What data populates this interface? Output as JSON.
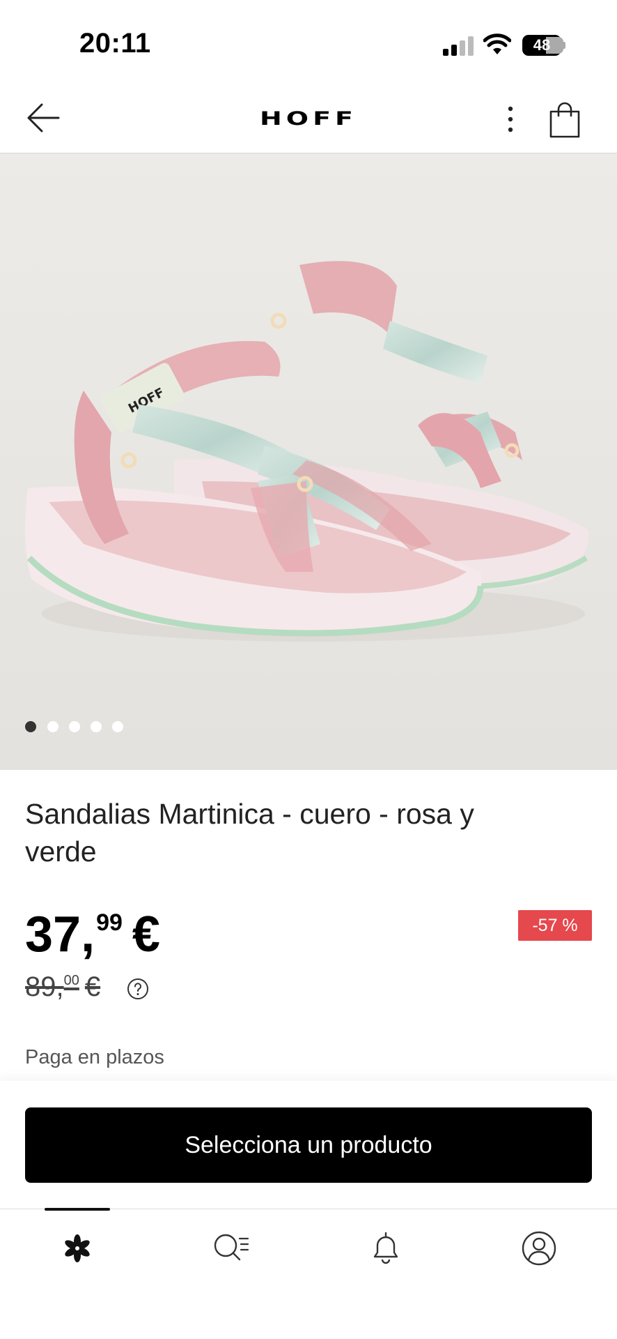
{
  "status_bar": {
    "time": "20:11",
    "battery": "48"
  },
  "header": {
    "brand": "HOFF",
    "icons": [
      "back-arrow-icon",
      "more-vertical-icon",
      "shopping-bag-icon"
    ]
  },
  "gallery": {
    "image_alt": "Sandalias Martinica rosa y verde",
    "dots": 5,
    "active_dot": 1,
    "brand_tag": "HOFF"
  },
  "product": {
    "title": "Sandalias Martinica - cuero - rosa y verde",
    "price_int": "37,",
    "price_dec": "99",
    "price_currency": "€",
    "discount": "-57 %",
    "old_price_int": "89,",
    "old_price_dec": "00",
    "old_price_currency": "€",
    "installments": "Paga en plazos"
  },
  "cta": {
    "label": "Selecciona un producto"
  },
  "bottom_nav": {
    "items": [
      "home-flower-icon",
      "search-list-icon",
      "bell-icon",
      "profile-icon"
    ],
    "active": 0
  },
  "colors": {
    "discount_red": "#e5484d",
    "cta_black": "#000000",
    "image_bg": "#eae8e4"
  }
}
